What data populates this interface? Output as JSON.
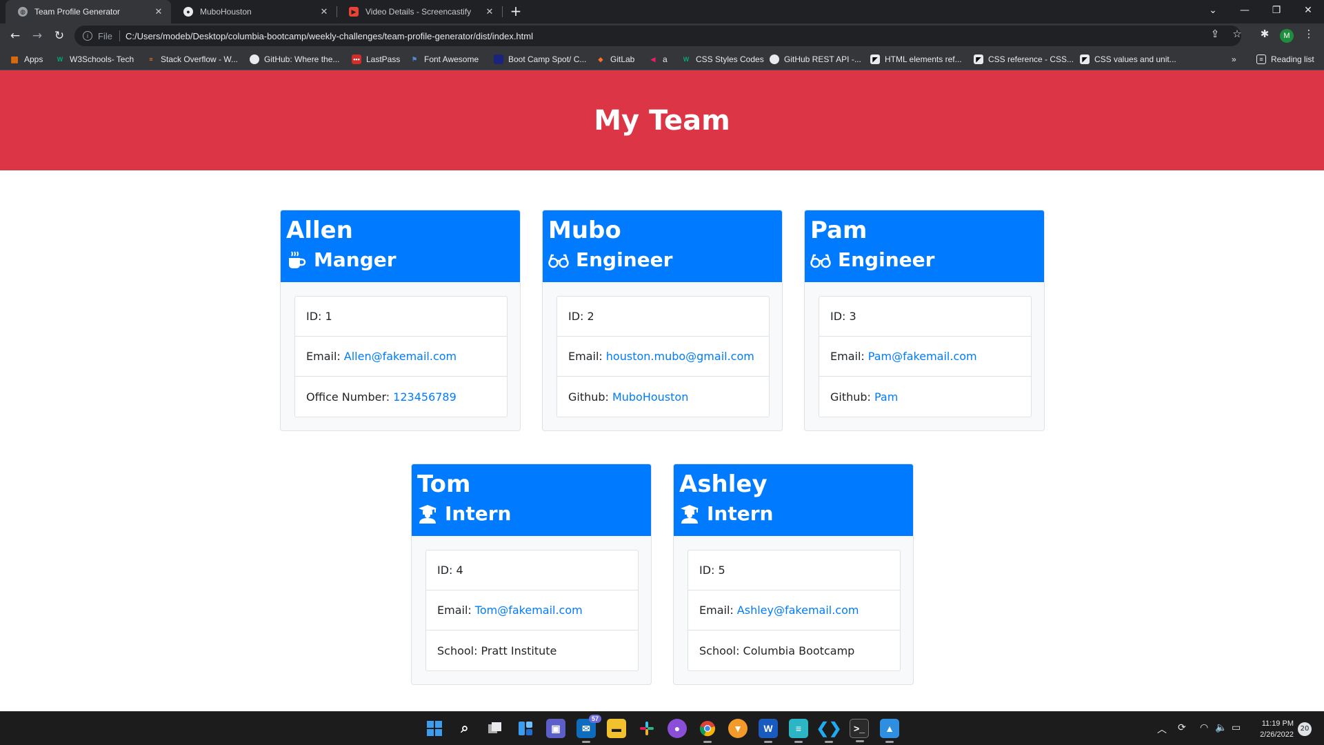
{
  "browser": {
    "tabs": [
      {
        "title": "Team Profile Generator",
        "active": true
      },
      {
        "title": "MuboHouston",
        "active": false
      },
      {
        "title": "Video Details - Screencastify",
        "active": false
      }
    ],
    "omnibox": {
      "scheme_label": "File",
      "url": "C:/Users/modeb/Desktop/columbia-bootcamp/weekly-challenges/team-profile-generator/dist/index.html"
    },
    "profile_initial": "M",
    "bookmarks": [
      {
        "label": "Apps",
        "color": "#e8710a"
      },
      {
        "label": "W3Schools- Tech",
        "color": "#04aa6d"
      },
      {
        "label": "Stack Overflow - W...",
        "color": "#f48024"
      },
      {
        "label": "GitHub: Where the...",
        "color": "#e8eaed"
      },
      {
        "label": "LastPass",
        "color": "#d32d27"
      },
      {
        "label": "Font Awesome",
        "color": "#528dd7"
      },
      {
        "label": "Boot Camp Spot/ C...",
        "color": "#1a237e"
      },
      {
        "label": "GitLab",
        "color": "#fc6d26"
      },
      {
        "label": "a",
        "color": "#e91e63"
      },
      {
        "label": "CSS Styles Codes",
        "color": "#04aa6d"
      },
      {
        "label": "GitHub REST API -...",
        "color": "#e8eaed"
      },
      {
        "label": "HTML elements ref...",
        "color": "#e8eaed"
      },
      {
        "label": "CSS reference - CSS...",
        "color": "#e8eaed"
      },
      {
        "label": "CSS values and unit...",
        "color": "#e8eaed"
      }
    ],
    "reading_list": "Reading list"
  },
  "page": {
    "heading": "My Team",
    "header_color": "#dc3545",
    "card_header_color": "#007bff",
    "link_color": "#007bff",
    "employees": [
      {
        "name": "Allen",
        "role": "Manger",
        "role_icon": "mug-icon",
        "id_label": "ID:",
        "id": "1",
        "email_label": "Email:",
        "email": "Allen@fakemail.com",
        "extra_label": "Office Number:",
        "extra": "123456789",
        "extra_is_link": true
      },
      {
        "name": "Mubo",
        "role": "Engineer",
        "role_icon": "glasses-icon",
        "id_label": "ID:",
        "id": "2",
        "email_label": "Email:",
        "email": "houston.mubo@gmail.com",
        "extra_label": "Github:",
        "extra": "MuboHouston",
        "extra_is_link": true
      },
      {
        "name": "Pam",
        "role": "Engineer",
        "role_icon": "glasses-icon",
        "id_label": "ID:",
        "id": "3",
        "email_label": "Email:",
        "email": "Pam@fakemail.com",
        "extra_label": "Github:",
        "extra": "Pam",
        "extra_is_link": true
      },
      {
        "name": "Tom",
        "role": "Intern",
        "role_icon": "graduate-icon",
        "id_label": "ID:",
        "id": "4",
        "email_label": "Email:",
        "email": "Tom@fakemail.com",
        "extra_label": "School:",
        "extra": "Pratt Institute",
        "extra_is_link": false
      },
      {
        "name": "Ashley",
        "role": "Intern",
        "role_icon": "graduate-icon",
        "id_label": "ID:",
        "id": "5",
        "email_label": "Email:",
        "email": "Ashley@fakemail.com",
        "extra_label": "School:",
        "extra": "Columbia Bootcamp",
        "extra_is_link": false
      }
    ]
  },
  "taskbar": {
    "mail_badge": "57",
    "time": "11:19 PM",
    "date": "2/26/2022",
    "notification_count": "20"
  }
}
